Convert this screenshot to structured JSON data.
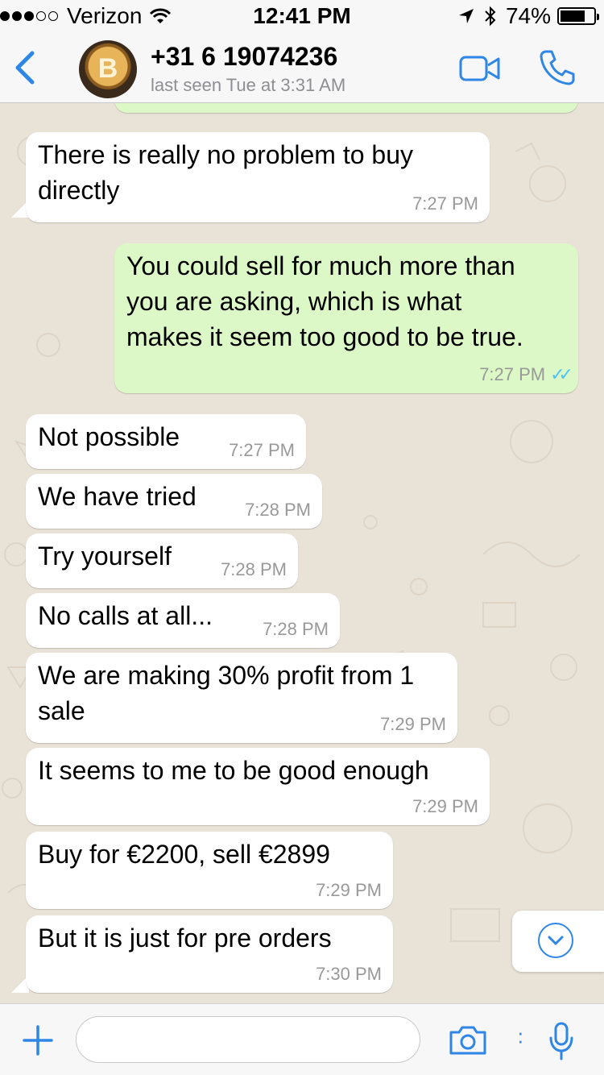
{
  "status_bar": {
    "carrier": "Verizon",
    "time": "12:41 PM",
    "battery": "74%",
    "battery_level": 0.74
  },
  "header": {
    "back_icon": "chevron-left-icon",
    "avatar_icon": "bitcoin-coin-avatar",
    "contact": "+31 6 19074236",
    "last_seen": "last seen Tue at 3:31 AM",
    "video_icon": "video-call-icon",
    "phone_icon": "phone-icon"
  },
  "messages": [
    {
      "dir": "in",
      "lines": [
        "There is really no problem to buy",
        "directly"
      ],
      "time": "7:27 PM"
    },
    {
      "dir": "out",
      "lines": [
        "You could sell for much more than",
        "you are asking, which is what",
        "makes it seem too good to be true."
      ],
      "time": "7:27 PM",
      "ticks": "✓✓"
    },
    {
      "dir": "in",
      "lines": [
        "Not possible"
      ],
      "time": "7:27 PM"
    },
    {
      "dir": "in",
      "lines": [
        "We have tried"
      ],
      "time": "7:28 PM"
    },
    {
      "dir": "in",
      "lines": [
        "Try yourself"
      ],
      "time": "7:28 PM"
    },
    {
      "dir": "in",
      "lines": [
        "No calls at all..."
      ],
      "time": "7:28 PM"
    },
    {
      "dir": "in",
      "lines": [
        "We are making 30% profit from 1",
        "sale"
      ],
      "time": "7:29 PM"
    },
    {
      "dir": "in",
      "lines": [
        "It seems to me to be good enough"
      ],
      "time": "7:29 PM"
    },
    {
      "dir": "in",
      "lines": [
        "Buy for €2200, sell €2899"
      ],
      "time": "7:29 PM"
    },
    {
      "dir": "in",
      "lines": [
        "But it is just for pre orders"
      ],
      "time": "7:30 PM"
    }
  ],
  "scroll_button_icon": "chevron-down-circle-icon",
  "input_bar": {
    "plus_icon": "plus-icon",
    "message_placeholder": "",
    "camera_icon": "camera-icon",
    "mic_icon": "microphone-icon"
  },
  "colors": {
    "accent": "#2e86e6",
    "outgoing_bubble": "#dcf8c6",
    "incoming_bubble": "#ffffff",
    "chat_background": "#e9e2d6",
    "read_ticks": "#4fc3f7"
  }
}
